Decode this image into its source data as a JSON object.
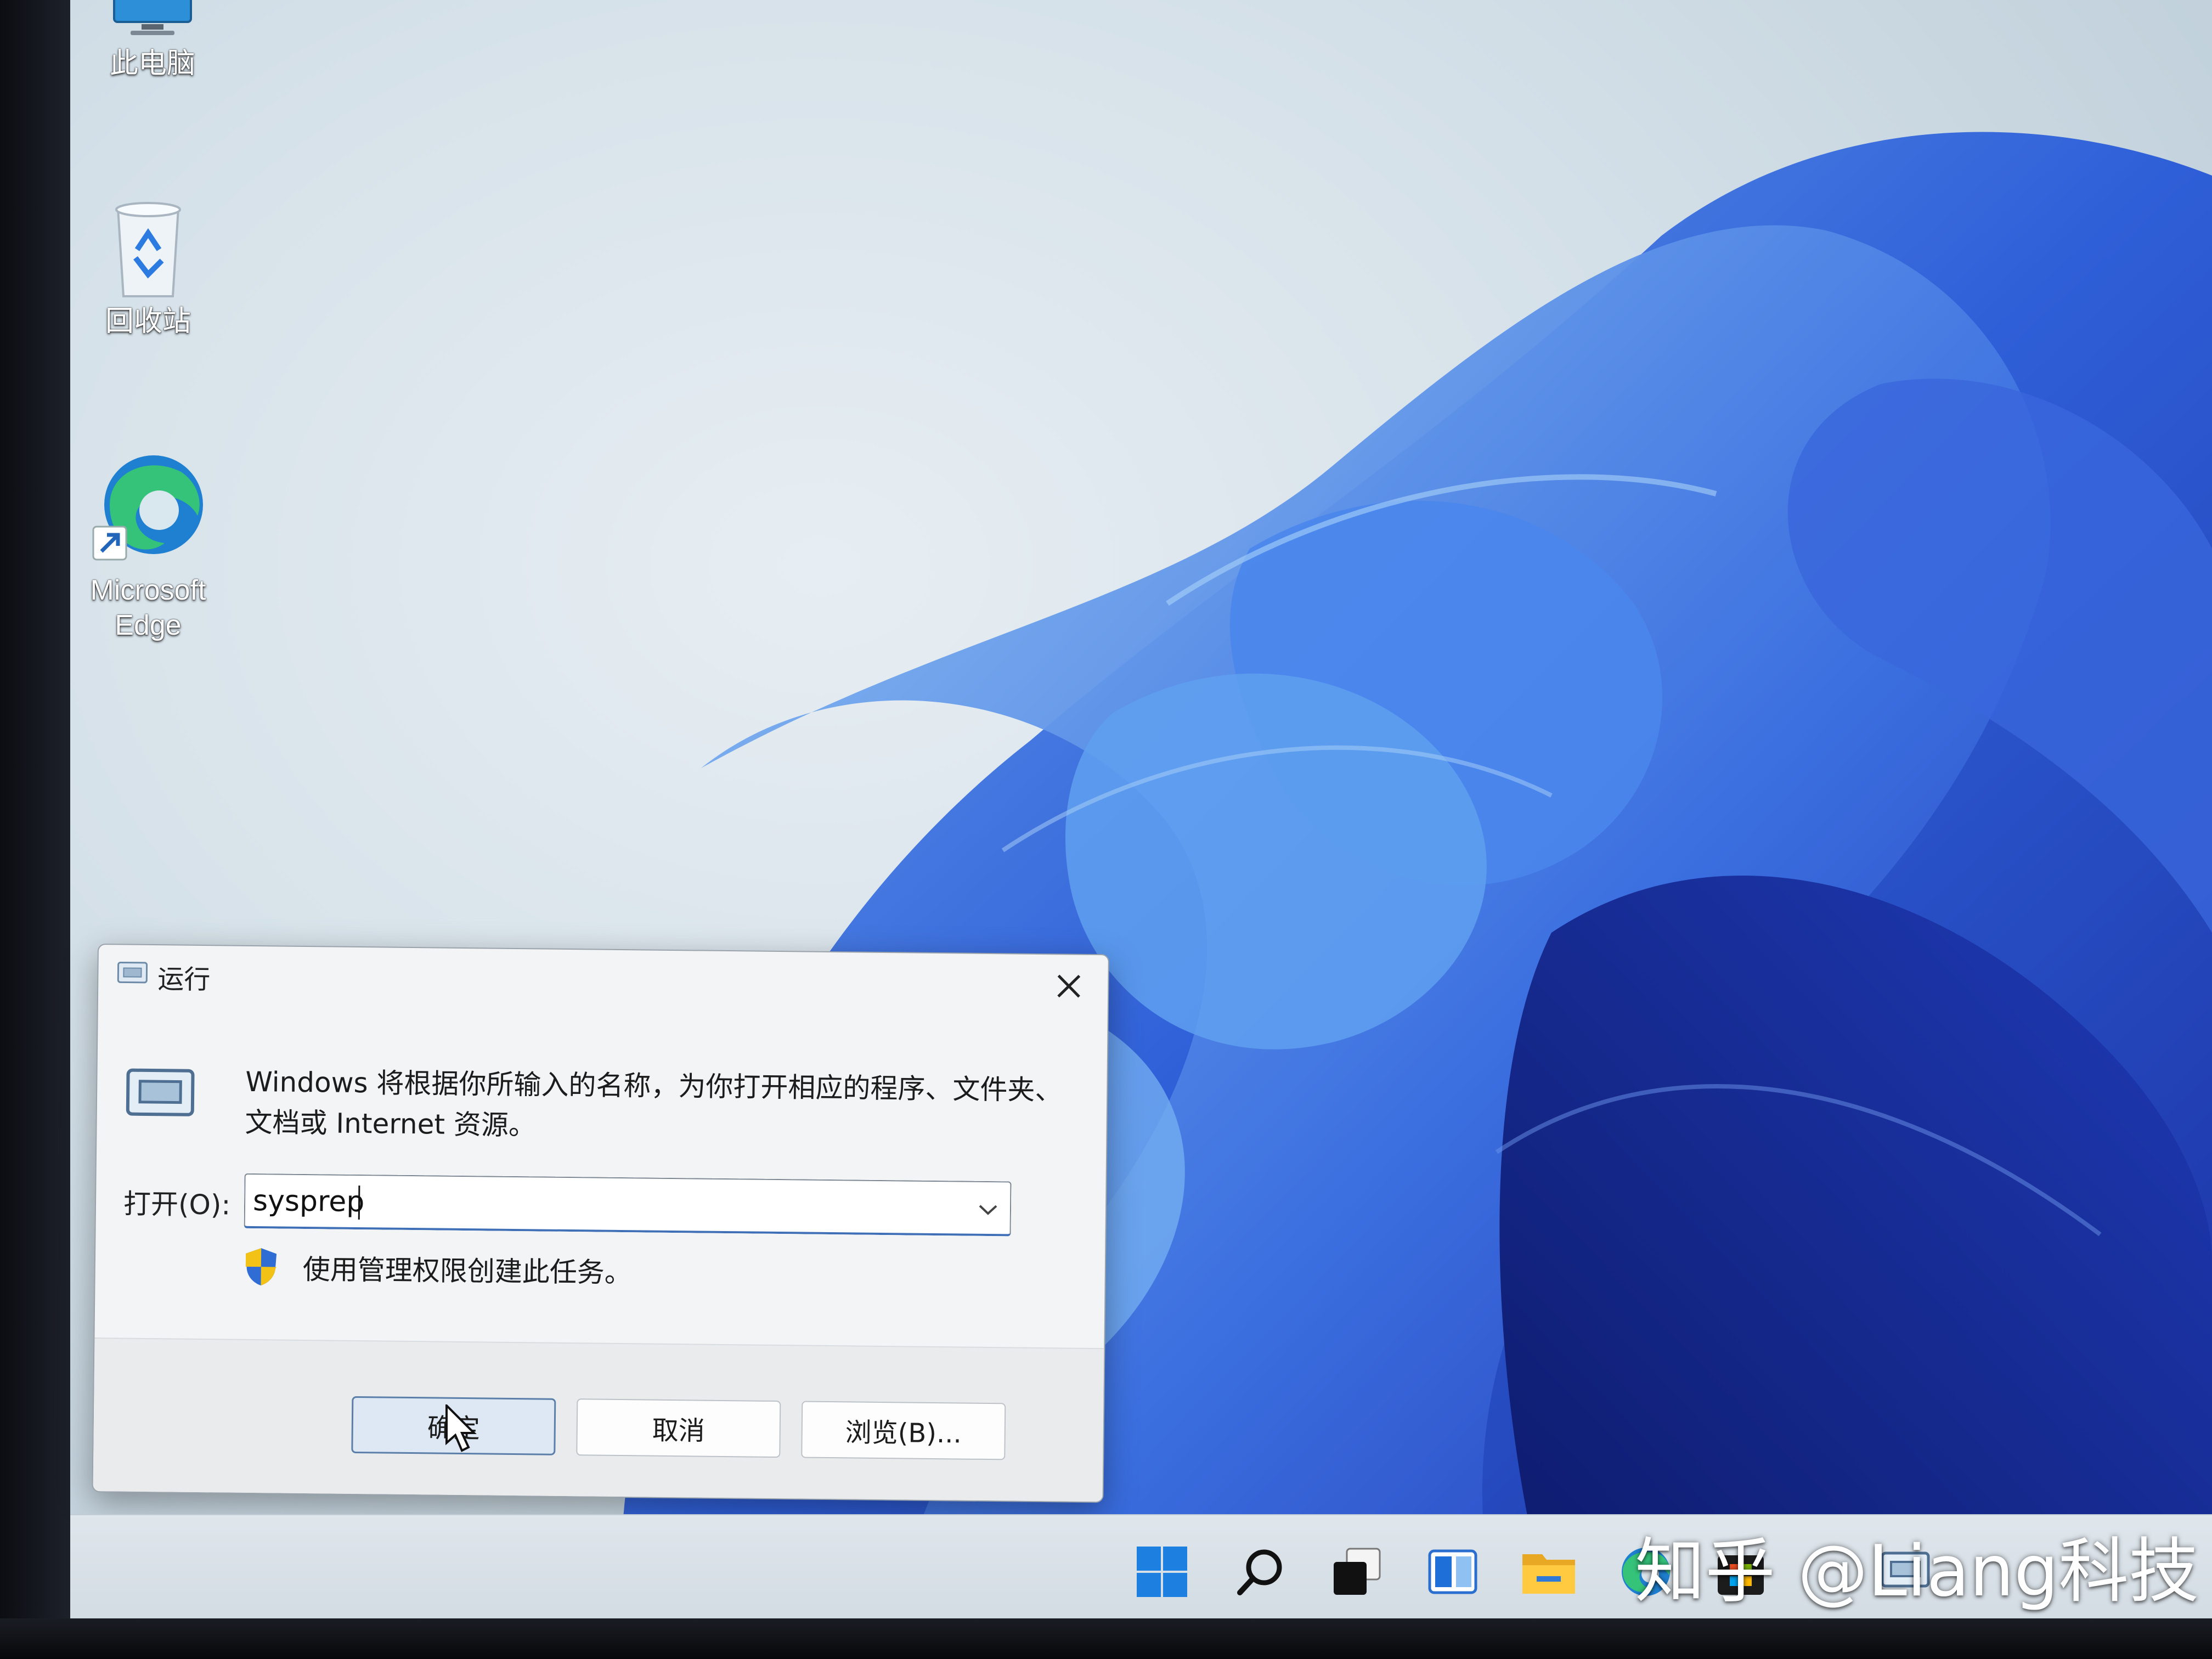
{
  "desktop": {
    "icons": [
      {
        "label": "此电脑",
        "icon": "computer-icon"
      },
      {
        "label": "回收站",
        "icon": "recycle-bin-icon"
      },
      {
        "label": "Microsoft Edge",
        "icon": "edge-icon"
      }
    ]
  },
  "run_dialog": {
    "title": "运行",
    "description": "Windows 将根据你所输入的名称，为你打开相应的程序、文件夹、文档或 Internet 资源。",
    "open_label": "打开(O):",
    "input_value": "sysprep",
    "admin_note": "使用管理权限创建此任务。",
    "buttons": {
      "ok": "确定",
      "cancel": "取消",
      "browse": "浏览(B)..."
    }
  },
  "taskbar": {
    "icons": [
      "windows-start-icon",
      "search-icon",
      "task-view-icon",
      "widgets-icon",
      "file-explorer-icon",
      "edge-icon",
      "store-icon",
      "run-app-icon"
    ]
  },
  "watermark": "知乎 @Liang科技",
  "colors": {
    "wallpaper_bloom": "#2f5fd8",
    "wallpaper_bg": "#d4e0e8",
    "accent": "#3f6fb6"
  }
}
